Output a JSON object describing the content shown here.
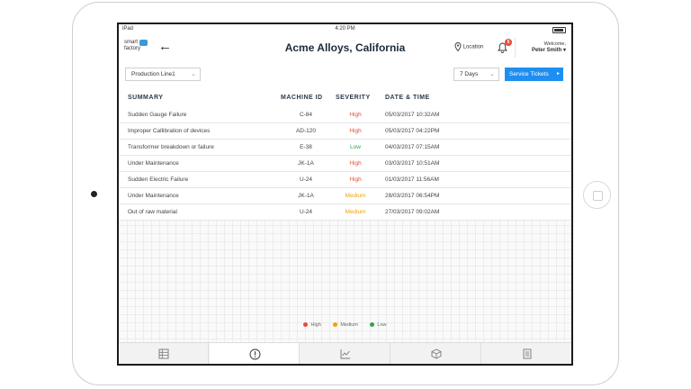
{
  "status_bar": {
    "carrier": "iPad",
    "time": "4:20 PM"
  },
  "app": {
    "logo_text_1": "smart",
    "logo_text_2": "factory",
    "back_icon": "arrow-left-icon",
    "title": "Acme Alloys, California",
    "location_label": "Location",
    "notification_count": "5",
    "welcome_label": "Welcome,",
    "user_name": "Peter Smith"
  },
  "filters": {
    "line_value": "Production Line1",
    "period_value": "7 Days",
    "service_tickets_label": "Service Tickets"
  },
  "table": {
    "headers": [
      "SUMMARY",
      "MACHINE ID",
      "SEVERITY",
      "DATE & TIME"
    ],
    "rows": [
      {
        "summary": "Sudden Gauge Failure",
        "machine_id": "C-84",
        "severity": "High",
        "datetime": "05/03/2017 10:32AM"
      },
      {
        "summary": "Improper Callibration of devices",
        "machine_id": "AD-120",
        "severity": "High",
        "datetime": "05/03/2017 04:22PM"
      },
      {
        "summary": "Transformer breakdown or failure",
        "machine_id": "E-38",
        "severity": "Low",
        "datetime": "04/03/2017 07:15AM"
      },
      {
        "summary": "Under Maintenance",
        "machine_id": "JK-1A",
        "severity": "High",
        "datetime": "03/03/2017 10:51AM"
      },
      {
        "summary": "Sudden Electric Failure",
        "machine_id": "U-24",
        "severity": "High",
        "datetime": "01/03/2017 11:56AM"
      },
      {
        "summary": "Under Maintenance",
        "machine_id": "JK-1A",
        "severity": "Medium",
        "datetime": "28/03/2017 06:54PM"
      },
      {
        "summary": "Out of raw material",
        "machine_id": "U-24",
        "severity": "Medium",
        "datetime": "27/03/2017 09:02AM"
      }
    ]
  },
  "severity_colors": {
    "High": "#e74c3c",
    "Medium": "#f0a30a",
    "Low": "#3aa14a"
  },
  "legend": {
    "high": "High",
    "medium": "Medium",
    "low": "Low"
  },
  "tabs": [
    {
      "icon": "table-icon",
      "active": false
    },
    {
      "icon": "alert-icon",
      "active": true
    },
    {
      "icon": "chart-icon",
      "active": false
    },
    {
      "icon": "box-icon",
      "active": false
    },
    {
      "icon": "report-icon",
      "active": false
    }
  ]
}
